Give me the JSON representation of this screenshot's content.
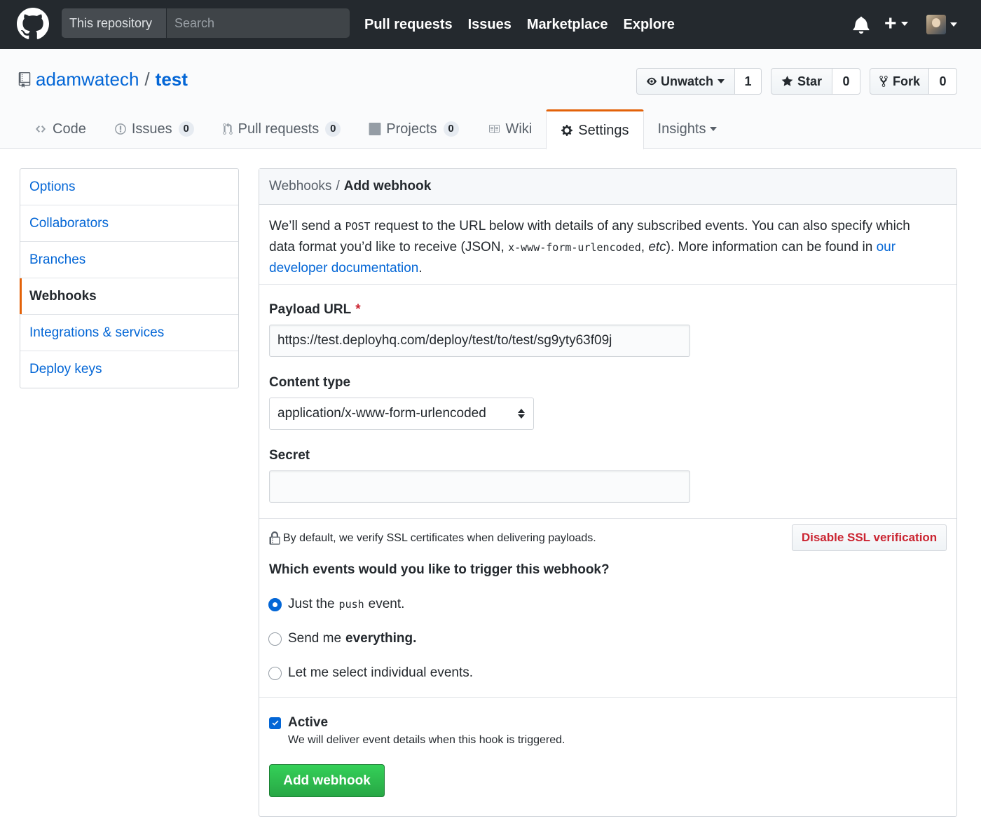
{
  "header": {
    "search_scope": "This repository",
    "search_placeholder": "Search",
    "nav": [
      "Pull requests",
      "Issues",
      "Marketplace",
      "Explore"
    ],
    "plus": "+"
  },
  "repo": {
    "owner": "adamwatech",
    "separator": "/",
    "name": "test",
    "unwatch_label": "Unwatch",
    "watch_count": "1",
    "star_label": "Star",
    "star_count": "0",
    "fork_label": "Fork",
    "fork_count": "0"
  },
  "tabs": {
    "code": "Code",
    "issues": "Issues",
    "issues_count": "0",
    "pulls": "Pull requests",
    "pulls_count": "0",
    "projects": "Projects",
    "projects_count": "0",
    "wiki": "Wiki",
    "settings": "Settings",
    "insights": "Insights"
  },
  "sidebar": {
    "items": [
      "Options",
      "Collaborators",
      "Branches",
      "Webhooks",
      "Integrations & services",
      "Deploy keys"
    ],
    "selected": "Webhooks"
  },
  "breadcrumb": {
    "parent": "Webhooks",
    "separator": "/",
    "current": "Add webhook"
  },
  "intro": {
    "part1": "We’ll send a ",
    "code1": "POST",
    "part2": " request to the URL below with details of any subscribed events. You can also specify which data format you’d like to receive (JSON, ",
    "code2": "x-www-form-urlencoded",
    "part3": ", ",
    "etc": "etc",
    "part4": "). More information can be found in ",
    "link": "our developer documentation",
    "part5": "."
  },
  "form": {
    "payload_label": "Payload URL",
    "required_mark": "*",
    "payload_value": "https://test.deployhq.com/deploy/test/to/test/sg9yty63f09j",
    "content_type_label": "Content type",
    "content_type_value": "application/x-www-form-urlencoded",
    "secret_label": "Secret",
    "secret_value": "",
    "ssl_note": "By default, we verify SSL certificates when delivering payloads.",
    "ssl_button": "Disable SSL verification",
    "events_question": "Which events would you like to trigger this webhook?",
    "radio1_pre": "Just the",
    "radio1_code": "push",
    "radio1_post": "event.",
    "radio2_pre": "Send me",
    "radio2_bold": "everything.",
    "radio3": "Let me select individual events.",
    "active_label": "Active",
    "active_note": "We will deliver event details when this hook is triggered.",
    "submit": "Add webhook"
  },
  "colors": {
    "header_bg": "#24292e",
    "link": "#0366d6",
    "accent": "#e36209",
    "danger": "#cb2431",
    "primary_btn": "#28a745"
  }
}
